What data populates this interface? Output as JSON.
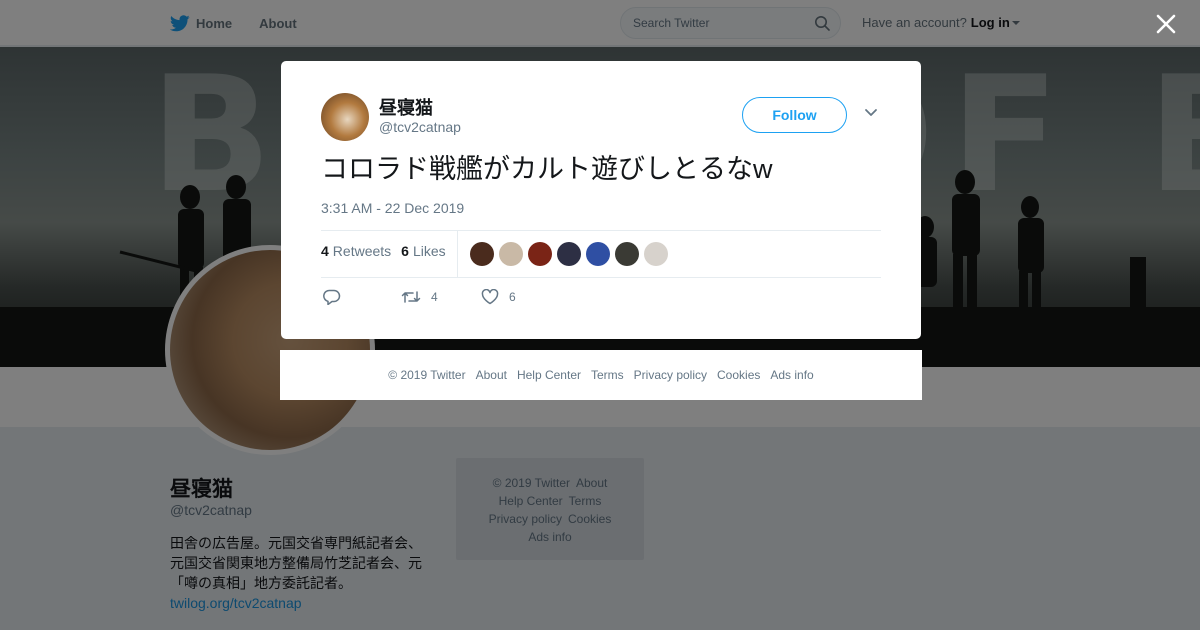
{
  "nav": {
    "home_label": "Home",
    "about_label": "About",
    "search_placeholder": "Search Twitter",
    "account_text": "Have an account?",
    "login_label": "Log in"
  },
  "banner": {
    "text": "BAND OF BROTHERS"
  },
  "profile": {
    "name": "昼寝猫",
    "handle": "@tcv2catnap",
    "bio": "田舎の広告屋。元国交省専門紙記者会、元国交省関東地方整備局竹芝記者会、元「噂の真相」地方委託記者。",
    "bio_link": "twilog.org/tcv2catnap"
  },
  "side_footer": {
    "copyright": "© 2019 Twitter",
    "about": "About",
    "help": "Help Center",
    "terms": "Terms",
    "privacy": "Privacy policy",
    "cookies": "Cookies",
    "ads": "Ads info"
  },
  "tweet": {
    "author_name": "昼寝猫",
    "author_handle": "@tcv2catnap",
    "follow_label": "Follow",
    "text": "コロラド戦艦がカルト遊びしとるなw",
    "timestamp": "3:31 AM - 22 Dec 2019",
    "retweets_count": "4",
    "retweets_label": "Retweets",
    "likes_count": "6",
    "likes_label": "Likes",
    "action_retweet_count": "4",
    "action_like_count": "6",
    "liker_avatar_colors": [
      "#4a2b1d",
      "#c9b9a6",
      "#7a2416",
      "#2d2f44",
      "#2f4fa3",
      "#3a3a34",
      "#d7d2cc"
    ]
  },
  "modal_footer": {
    "copyright": "© 2019 Twitter",
    "about": "About",
    "help": "Help Center",
    "terms": "Terms",
    "privacy": "Privacy policy",
    "cookies": "Cookies",
    "ads": "Ads info"
  },
  "colors": {
    "accent": "#1da1f2",
    "link": "#1b95e0",
    "secondary_text": "#657786"
  }
}
